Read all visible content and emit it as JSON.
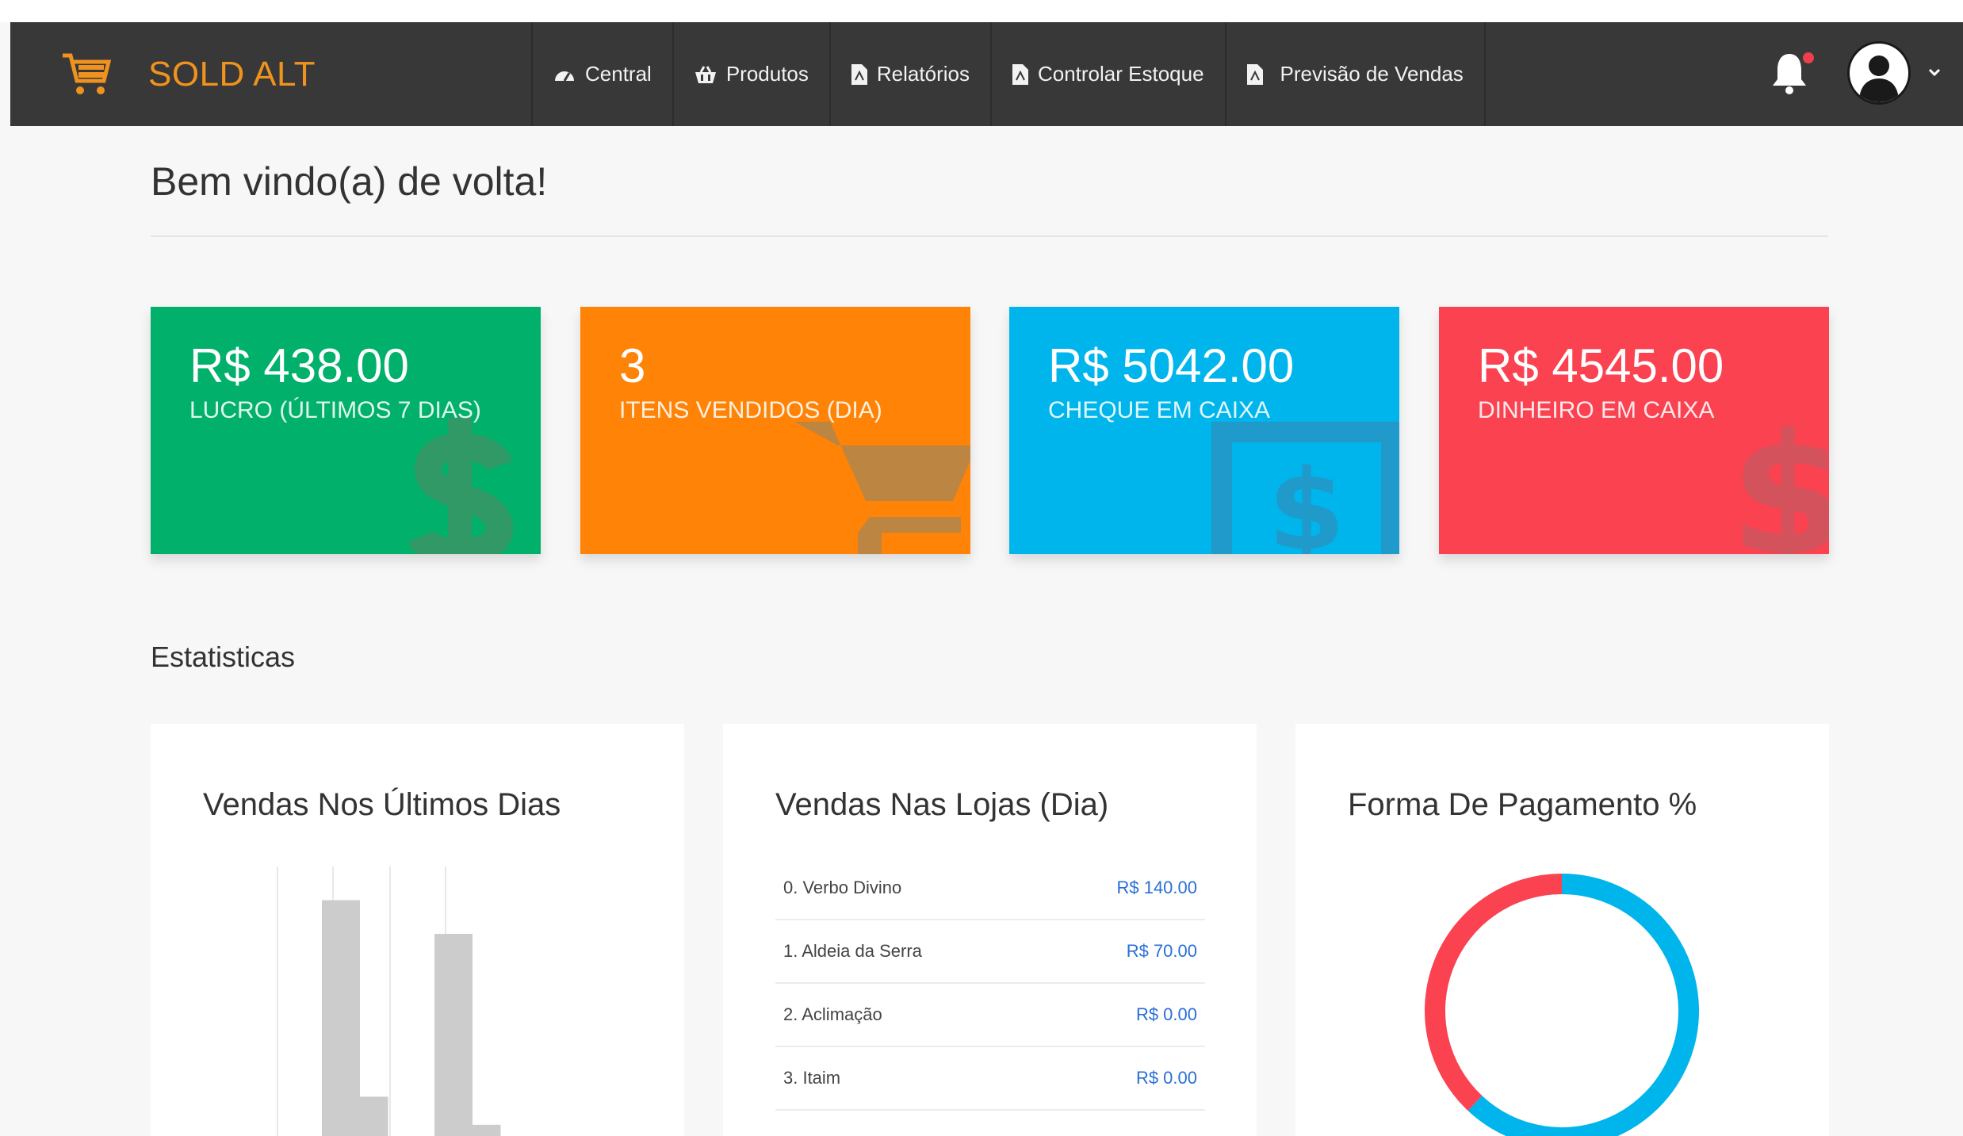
{
  "brand": {
    "name": "SOLD ALT",
    "color": "#f0931e"
  },
  "nav": {
    "items": [
      {
        "label": "Central",
        "icon": "dashboard-icon"
      },
      {
        "label": "Produtos",
        "icon": "basket-icon"
      },
      {
        "label": "Relatórios",
        "icon": "file-pdf-icon"
      },
      {
        "label": "Controlar Estoque",
        "icon": "file-pdf-icon"
      },
      {
        "label": "Previsão de Vendas",
        "icon": "file-pdf-icon"
      }
    ],
    "notification_icon": "bell-icon",
    "avatar_icon": "user-avatar-icon"
  },
  "page": {
    "welcome": "Bem vindo(a) de volta!",
    "stats_title": "Estatisticas"
  },
  "cards": [
    {
      "value": "R$ 438.00",
      "label": "LUCRO (ÚLTIMOS 7 DIAS)",
      "color": "#00b06b",
      "icon": "dollar-icon"
    },
    {
      "value": "3",
      "label": "ITENS VENDIDOS (DIA)",
      "color": "#ff8307",
      "icon": "shopping-cart-icon"
    },
    {
      "value": "R$ 5042.00",
      "label": "CHEQUE EM CAIXA",
      "color": "#00b5eb",
      "icon": "money-check-icon"
    },
    {
      "value": "R$ 4545.00",
      "label": "DINHEIRO EM CAIXA",
      "color": "#fa4251",
      "icon": "dollar-icon"
    }
  ],
  "panels": {
    "sales_days": {
      "title": "Vendas Nos Últimos Dias",
      "chart_data": {
        "type": "bar",
        "values": [
          0,
          0,
          210,
          35,
          0,
          0,
          180,
          10
        ],
        "note_hidden": ""
      }
    },
    "stores": {
      "title": "Vendas Nas Lojas (Dia)",
      "rows": [
        {
          "name": "0. Verbo Divino",
          "value": "R$ 140.00"
        },
        {
          "name": "1. Aldeia da Serra",
          "value": "R$ 70.00"
        },
        {
          "name": "2. Aclimação",
          "value": "R$ 0.00"
        },
        {
          "name": "3. Itaim",
          "value": "R$ 0.00"
        }
      ]
    },
    "payment": {
      "title": "Forma De Pagamento %",
      "chart_data": {
        "type": "pie",
        "series": [
          {
            "values": [
              62
            ]
          },
          {
            "values": [
              38
            ]
          }
        ],
        "colors": [
          "#00b5eb",
          "#fa4251"
        ]
      }
    }
  }
}
